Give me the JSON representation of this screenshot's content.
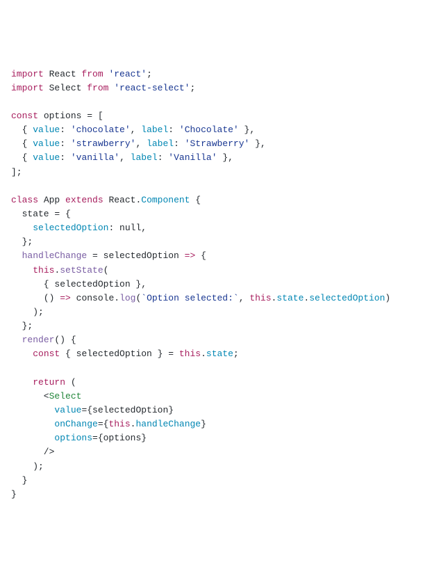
{
  "code": {
    "line1_import": "import",
    "line1_react": " React ",
    "line1_from": "from",
    "line1_str": " 'react'",
    "line1_end": ";",
    "line2_import": "import",
    "line2_select": " Select ",
    "line2_from": "from",
    "line2_str": " 'react-select'",
    "line2_end": ";",
    "line4_const": "const",
    "line4_options": " options = [",
    "line5_open": "  { ",
    "line5_value": "value",
    "line5_colon1": ": ",
    "line5_str1": "'chocolate'",
    "line5_comma": ", ",
    "line5_label": "label",
    "line5_colon2": ": ",
    "line5_str2": "'Chocolate'",
    "line5_close": " },",
    "line6_open": "  { ",
    "line6_value": "value",
    "line6_colon1": ": ",
    "line6_str1": "'strawberry'",
    "line6_comma": ", ",
    "line6_label": "label",
    "line6_colon2": ": ",
    "line6_str2": "'Strawberry'",
    "line6_close": " },",
    "line7_open": "  { ",
    "line7_value": "value",
    "line7_colon1": ": ",
    "line7_str1": "'vanilla'",
    "line7_comma": ", ",
    "line7_label": "label",
    "line7_colon2": ": ",
    "line7_str2": "'Vanilla'",
    "line7_close": " },",
    "line8": "];",
    "line10_class": "class",
    "line10_app": " App ",
    "line10_extends": "extends",
    "line10_react": " React",
    "line10_dot": ".",
    "line10_component": "Component",
    "line10_brace": " {",
    "line11_state": "  state = {",
    "line12_pad": "    ",
    "line12_selopt": "selectedOption",
    "line12_rest": ": null,",
    "line13": "  };",
    "line14_pad": "  ",
    "line14_handle": "handleChange",
    "line14_eq": " = ",
    "line14_param": "selectedOption",
    "line14_arrow": " =>",
    "line14_brace": " {",
    "line15_pad": "    ",
    "line15_this": "this",
    "line15_dot": ".",
    "line15_setstate": "setState",
    "line15_paren": "(",
    "line16": "      { selectedOption },",
    "line17_pad": "      () ",
    "line17_arrow": "=>",
    "line17_sp": " ",
    "line17_console": "console",
    "line17_dot1": ".",
    "line17_log": "log",
    "line17_open": "(",
    "line17_tmpl": "`Option selected:`",
    "line17_comma": ", ",
    "line17_this": "this",
    "line17_dot2": ".",
    "line17_state": "state",
    "line17_dot3": ".",
    "line17_selopt": "selectedOption",
    "line17_close": ")",
    "line18": "    );",
    "line19": "  };",
    "line20_pad": "  ",
    "line20_render": "render",
    "line20_rest": "() {",
    "line21_pad": "    ",
    "line21_const": "const",
    "line21_rest": " { selectedOption } = ",
    "line21_this": "this",
    "line21_dot": ".",
    "line21_state": "state",
    "line21_semi": ";",
    "line23_pad": "    ",
    "line23_return": "return",
    "line23_paren": " (",
    "line24_pad": "      <",
    "line24_select": "Select",
    "line25_pad": "        ",
    "line25_attr": "value",
    "line25_rest": "={selectedOption}",
    "line26_pad": "        ",
    "line26_attr": "onChange",
    "line26_eq": "={",
    "line26_this": "this",
    "line26_dot": ".",
    "line26_handle": "handleChange",
    "line26_close": "}",
    "line27_pad": "        ",
    "line27_attr": "options",
    "line27_rest": "={options}",
    "line28": "      />",
    "line29": "    );",
    "line30": "  }",
    "line31": "}"
  }
}
